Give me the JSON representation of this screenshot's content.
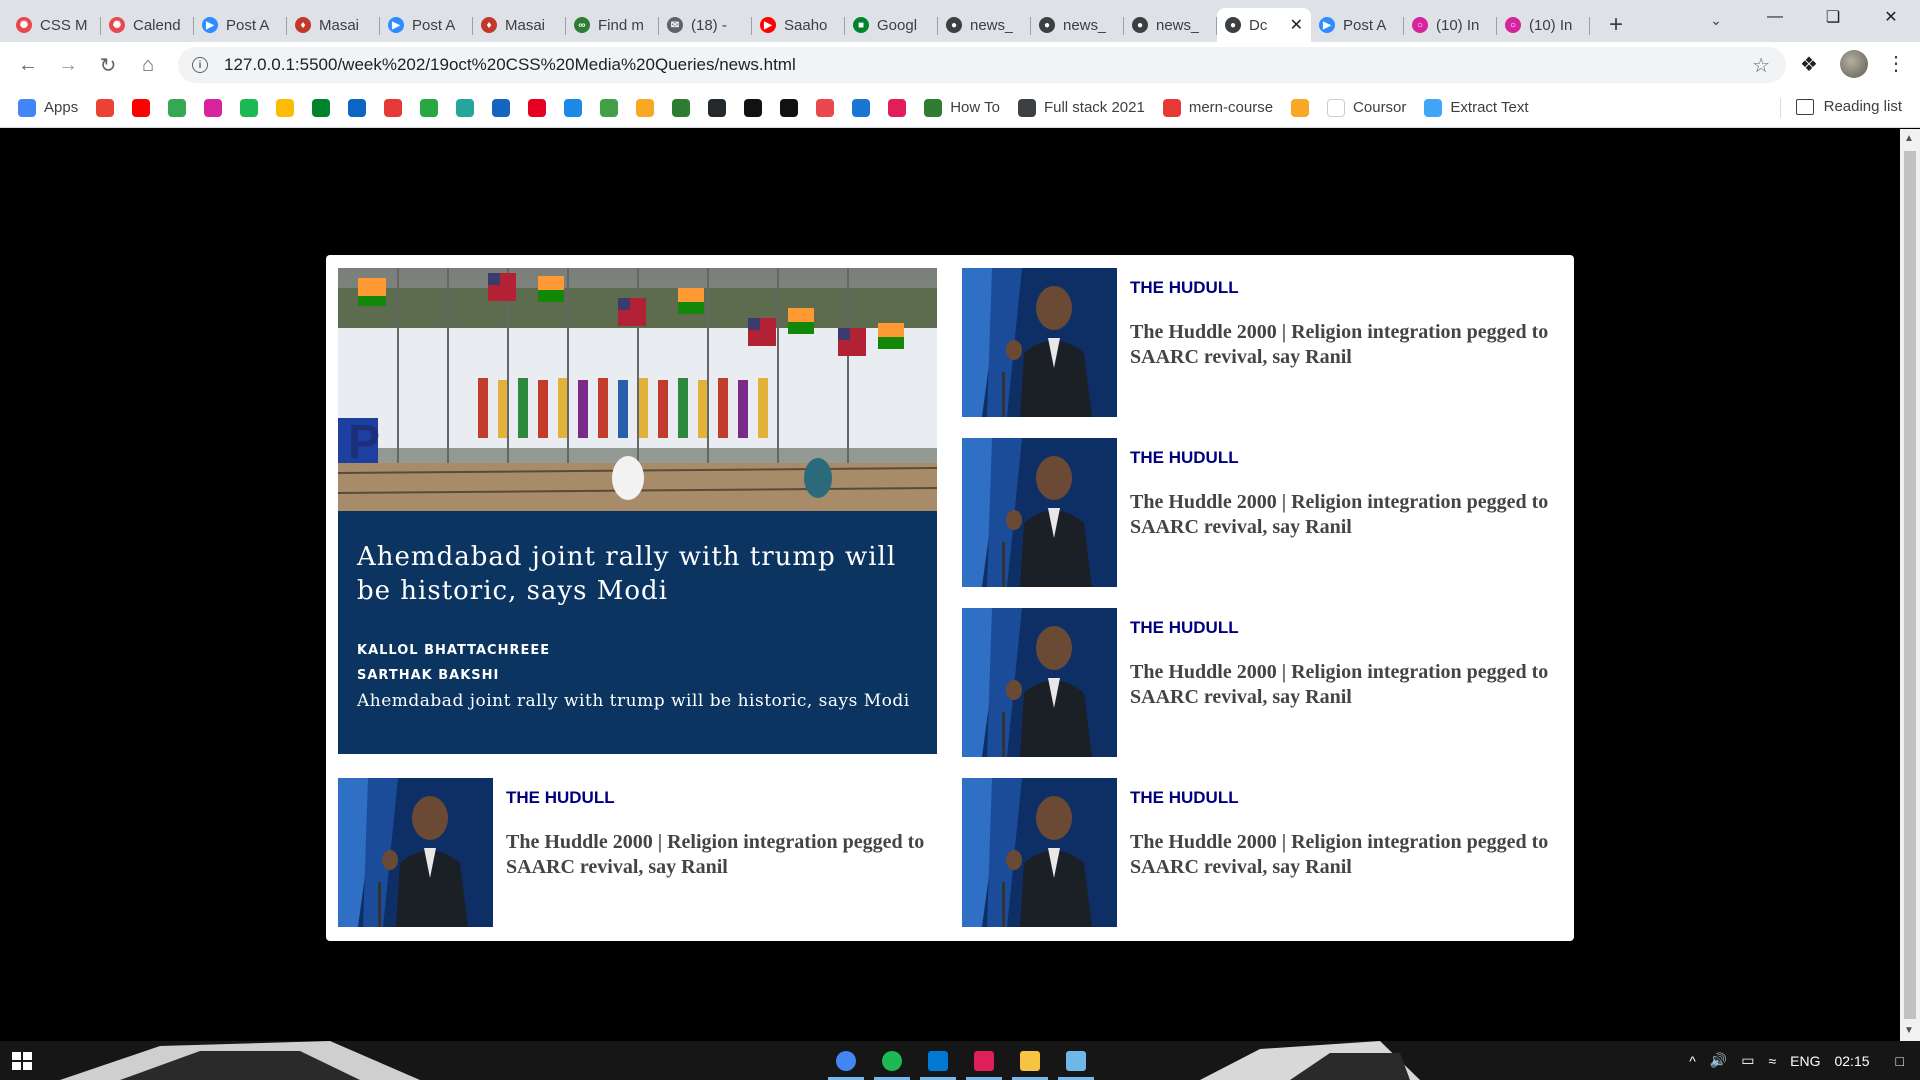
{
  "browser": {
    "tabs": [
      {
        "label": "CSS M",
        "icon": "asterisk-icon",
        "color": "#e8474c"
      },
      {
        "label": "Calend",
        "icon": "asterisk-icon",
        "color": "#e8474c"
      },
      {
        "label": "Post A",
        "icon": "zoom-icon",
        "color": "#2d8cff"
      },
      {
        "label": "Masai",
        "icon": "map-pin-icon",
        "color": "#c0392b"
      },
      {
        "label": "Post A",
        "icon": "zoom-icon",
        "color": "#2d8cff"
      },
      {
        "label": "Masai",
        "icon": "map-pin-icon",
        "color": "#c0392b"
      },
      {
        "label": "Find m",
        "icon": "link-icon",
        "color": "#2e7d32"
      },
      {
        "label": "(18) -",
        "icon": "inbox-icon",
        "color": "#5f6368"
      },
      {
        "label": "Saaho",
        "icon": "youtube-icon",
        "color": "#ff0000"
      },
      {
        "label": "Googl",
        "icon": "google-meet-icon",
        "color": "#00832d"
      },
      {
        "label": "news_",
        "icon": "globe-icon",
        "color": "#3c4043"
      },
      {
        "label": "news_",
        "icon": "globe-icon",
        "color": "#3c4043"
      },
      {
        "label": "news_",
        "icon": "globe-icon",
        "color": "#3c4043"
      },
      {
        "label": "Dc",
        "icon": "globe-icon",
        "color": "#3c4043",
        "active": true
      },
      {
        "label": "Post A",
        "icon": "zoom-icon",
        "color": "#2d8cff"
      },
      {
        "label": "(10) In",
        "icon": "instagram-icon",
        "color": "#d6249f"
      },
      {
        "label": "(10) In",
        "icon": "instagram-icon",
        "color": "#d6249f"
      }
    ],
    "new_tab_label": "+",
    "url": "127.0.0.1:5500/week%202/19oct%20CSS%20Media%20Queries/news.html",
    "bookmarks": [
      {
        "label": "Apps",
        "icon": "apps-grid-icon",
        "color": "#4285f4"
      },
      {
        "label": "",
        "icon": "gmail-icon",
        "color": "#ea4335"
      },
      {
        "label": "",
        "icon": "youtube-icon",
        "color": "#ff0000"
      },
      {
        "label": "",
        "icon": "counter-icon",
        "color": "#34a853"
      },
      {
        "label": "",
        "icon": "instagram-icon",
        "color": "#d6249f"
      },
      {
        "label": "",
        "icon": "spotify-icon",
        "color": "#1db954"
      },
      {
        "label": "",
        "icon": "drive-icon",
        "color": "#fbbc04"
      },
      {
        "label": "",
        "icon": "meet-icon",
        "color": "#00832d"
      },
      {
        "label": "",
        "icon": "linkedin-icon",
        "color": "#0a66c2"
      },
      {
        "label": "",
        "icon": "record-icon",
        "color": "#e53935"
      },
      {
        "label": "",
        "icon": "px-icon",
        "color": "#28a745"
      },
      {
        "label": "",
        "icon": "edit-icon",
        "color": "#26a69a"
      },
      {
        "label": "",
        "icon": "bug-icon",
        "color": "#1565c0"
      },
      {
        "label": "",
        "icon": "pinterest-icon",
        "color": "#e60023"
      },
      {
        "label": "",
        "icon": "flag-icon",
        "color": "#1e88e5"
      },
      {
        "label": "",
        "icon": "v-icon",
        "color": "#43a047"
      },
      {
        "label": "",
        "icon": "pma-icon",
        "color": "#f9a825"
      },
      {
        "label": "",
        "icon": "w-icon",
        "color": "#2e7d32"
      },
      {
        "label": "",
        "icon": "github-icon",
        "color": "#24292e"
      },
      {
        "label": "",
        "icon": "codepen-icon",
        "color": "#111111"
      },
      {
        "label": "",
        "icon": "square-icon",
        "color": "#111111"
      },
      {
        "label": "",
        "icon": "asterisk-icon",
        "color": "#e8474c"
      },
      {
        "label": "",
        "icon": "inbox-icon",
        "color": "#1976d2"
      },
      {
        "label": "",
        "icon": "slack-icon",
        "color": "#e01e5a"
      },
      {
        "label": "How To",
        "icon": "w-icon",
        "color": "#2e7d32"
      },
      {
        "label": "Full stack 2021",
        "icon": "bookmark-box-icon",
        "color": "#3c4043"
      },
      {
        "label": "mern-course",
        "icon": "m-circle-icon",
        "color": "#e53935"
      },
      {
        "label": "",
        "icon": "h-icon",
        "color": "#f9a825"
      },
      {
        "label": "Coursor",
        "icon": "c-circle-icon",
        "color": "#ffffff"
      },
      {
        "label": "Extract Text",
        "icon": "text-icon",
        "color": "#42a5f5"
      }
    ],
    "reading_list": "Reading list"
  },
  "page": {
    "featured": {
      "title": "Ahemdabad joint rally with trump will be historic, says Modi",
      "authors": [
        "KALLOL BHATTACHREEE",
        "SARTHAK BAKSHI"
      ],
      "description": "Ahemdabad joint rally with trump will be historic, says Modi"
    },
    "stories": [
      {
        "source": "THE HUDULL",
        "headline": "The Huddle 2000 | Religion integration pegged to SAARC revival, say Ranil"
      },
      {
        "source": "THE HUDULL",
        "headline": "The Huddle 2000 | Religion integration pegged to SAARC revival, say Ranil"
      },
      {
        "source": "THE HUDULL",
        "headline": "The Huddle 2000 | Religion integration pegged to SAARC revival, say Ranil"
      },
      {
        "source": "THE HUDULL",
        "headline": "The Huddle 2000 | Religion integration pegged to SAARC revival, say Ranil"
      },
      {
        "source": "THE HUDULL",
        "headline": "The Huddle 2000 | Religion integration pegged to SAARC revival, say Ranil"
      }
    ],
    "colors": {
      "featured_bg": "#0b3560",
      "source": "#00007f",
      "headline": "#444444"
    }
  },
  "taskbar": {
    "apps": [
      "chrome-icon",
      "spotify-icon",
      "vscode-icon",
      "slack-icon",
      "file-explorer-icon",
      "notepad-icon"
    ],
    "language": "ENG",
    "time": "02:15"
  }
}
